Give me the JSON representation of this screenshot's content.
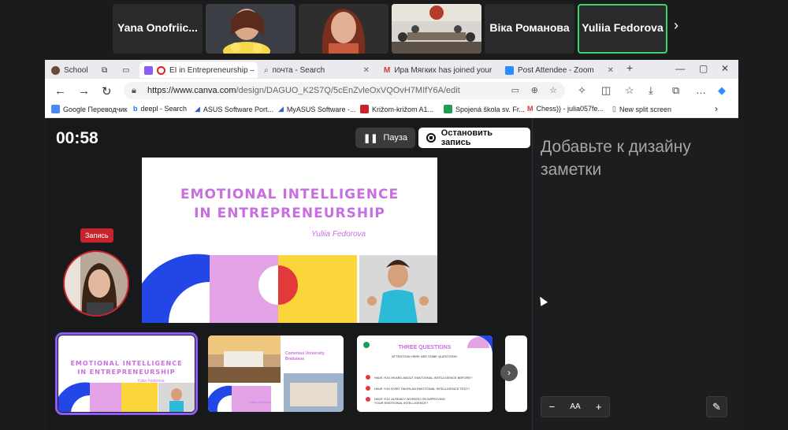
{
  "participants": [
    {
      "name": "Yana Onofriic...",
      "type": "text"
    },
    {
      "name": "",
      "type": "photo"
    },
    {
      "name": "",
      "type": "photo"
    },
    {
      "name": "",
      "type": "photo"
    },
    {
      "name": "Віка Романова",
      "type": "text"
    },
    {
      "name": "Yuliia Fedorova",
      "type": "text",
      "active": true
    }
  ],
  "participants_next": "›",
  "browser": {
    "profile": "School",
    "tabs": [
      {
        "label": "EI in Entrepreneurship –",
        "active": true
      },
      {
        "label": "почта - Search"
      },
      {
        "label": "Ира Мягких has joined your"
      },
      {
        "label": "Post Attendee - Zoom"
      }
    ],
    "new_tab": "+",
    "url_host": "https://www.canva.com",
    "url_path": "/design/DAGUO_K2S7Q/5cEnZvleOxVQOvH7MIfY6A/edit",
    "bookmarks": [
      "Google Переводчик",
      "deepl - Search",
      "ASUS Software Port...",
      "MyASUS Software -...",
      "Križom-križom A1...",
      "Spojená škola sv. Fr...",
      "Chess)) - julia057fe...",
      "New split screen"
    ]
  },
  "recorder": {
    "timer": "00:58",
    "pause_label": "Пауза",
    "stop_label": "Остановить запись",
    "rec_badge": "Запись"
  },
  "slide": {
    "title_line1": "EMOTIONAL INTELLIGENCE",
    "title_line2": "IN ENTREPRENEURSHIP",
    "author": "Yuliia Fedorova"
  },
  "thumbs": {
    "t1_line1": "EMOTIONAL INTELLIGENCE",
    "t1_line2": "IN ENTREPRENEURSHIP",
    "t1_author": "Yuliia Fedorova",
    "t2_title": "Comenius University Bratislava",
    "t2_author": "Yuliia Fedorova",
    "t3_title": "THREE QUESTIONS",
    "t3_sub": "ATTENTION! HERE ARE SOME QUESTIONS:",
    "t3_q1": "HAVE YOU HEARD ABOUT EMOTIONAL INTELLIGENCE BEFORE?",
    "t3_q2": "HAVE YOU EVER TAKEN AN EMOTIONAL INTELLIGENCE TEST?",
    "t3_q3": "HAVE YOU ALREADY WORKED ON IMPROVING YOUR EMOTIONAL INTELLIGENCE?",
    "next": "›"
  },
  "notes": {
    "placeholder": "Добавьте к дизайну заметки",
    "zoom_minus": "−",
    "zoom_aa": "AA",
    "zoom_plus": "+",
    "edit": "✎"
  },
  "colors": {
    "accent_purple": "#8b5cf6",
    "slide_pink": "#c86ee0",
    "slide_blue": "#2346e6",
    "slide_lilac": "#e3a3e6",
    "slide_yellow": "#fbd63a",
    "record_red": "#c8232c",
    "active_green": "#3bd36b"
  }
}
